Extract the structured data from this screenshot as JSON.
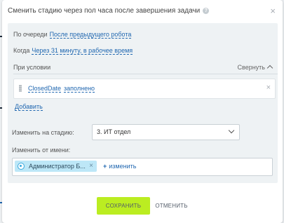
{
  "dialog": {
    "title": "Сменить стадию через пол часа после завершения задачи",
    "help_icon": "?",
    "close_icon": "×"
  },
  "settings": {
    "queue_label": "По очереди",
    "queue_value": "После предыдущего робота",
    "when_label": "Когда",
    "when_value": "Через 31 минуту, в рабочее время"
  },
  "condition": {
    "header": "При условии",
    "collapse_label": "Свернуть",
    "field": "ClosedDate",
    "operator": "заполнено",
    "remove_icon": "×",
    "add_label": "Добавить"
  },
  "stage": {
    "label": "Изменить на стадию:",
    "value": "3. ИТ отдел"
  },
  "from_user": {
    "label": "Изменить от имени:",
    "user": "Администратор Б...",
    "remove_icon": "×",
    "add_plus": "+",
    "add_label": "изменить"
  },
  "footer": {
    "save_label": "СОХРАНИТЬ",
    "cancel_label": "ОТМЕНИТЬ"
  },
  "colors": {
    "accent_link": "#2067b0",
    "save_button": "#bbed21",
    "user_tag": "#bde7f7"
  }
}
